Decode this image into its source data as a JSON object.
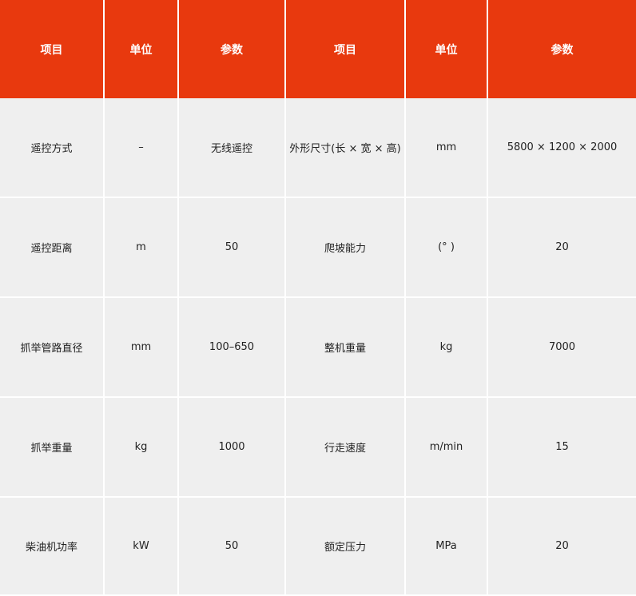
{
  "header": [
    "项目",
    "单位",
    "参数",
    "项目",
    "单位",
    "参数"
  ],
  "rows": [
    [
      "遥控方式",
      "–",
      "无线遥控",
      "外形尺寸(长 × 宽 × 高)",
      "mm",
      "5800 × 1200 × 2000"
    ],
    [
      "遥控距离",
      "m",
      "50",
      "爬坡能力",
      "(° )",
      "20"
    ],
    [
      "抓举管路直径",
      "mm",
      "100–650",
      "整机重量",
      "kg",
      "7000"
    ],
    [
      "抓举重量",
      "kg",
      "1000",
      "行走速度",
      "m/min",
      "15"
    ],
    [
      "柴油机功率",
      "kW",
      "50",
      "额定压力",
      "MPa",
      "20"
    ]
  ],
  "colors": {
    "header_bg": "#e8390e",
    "body_bg": "#efefef"
  }
}
